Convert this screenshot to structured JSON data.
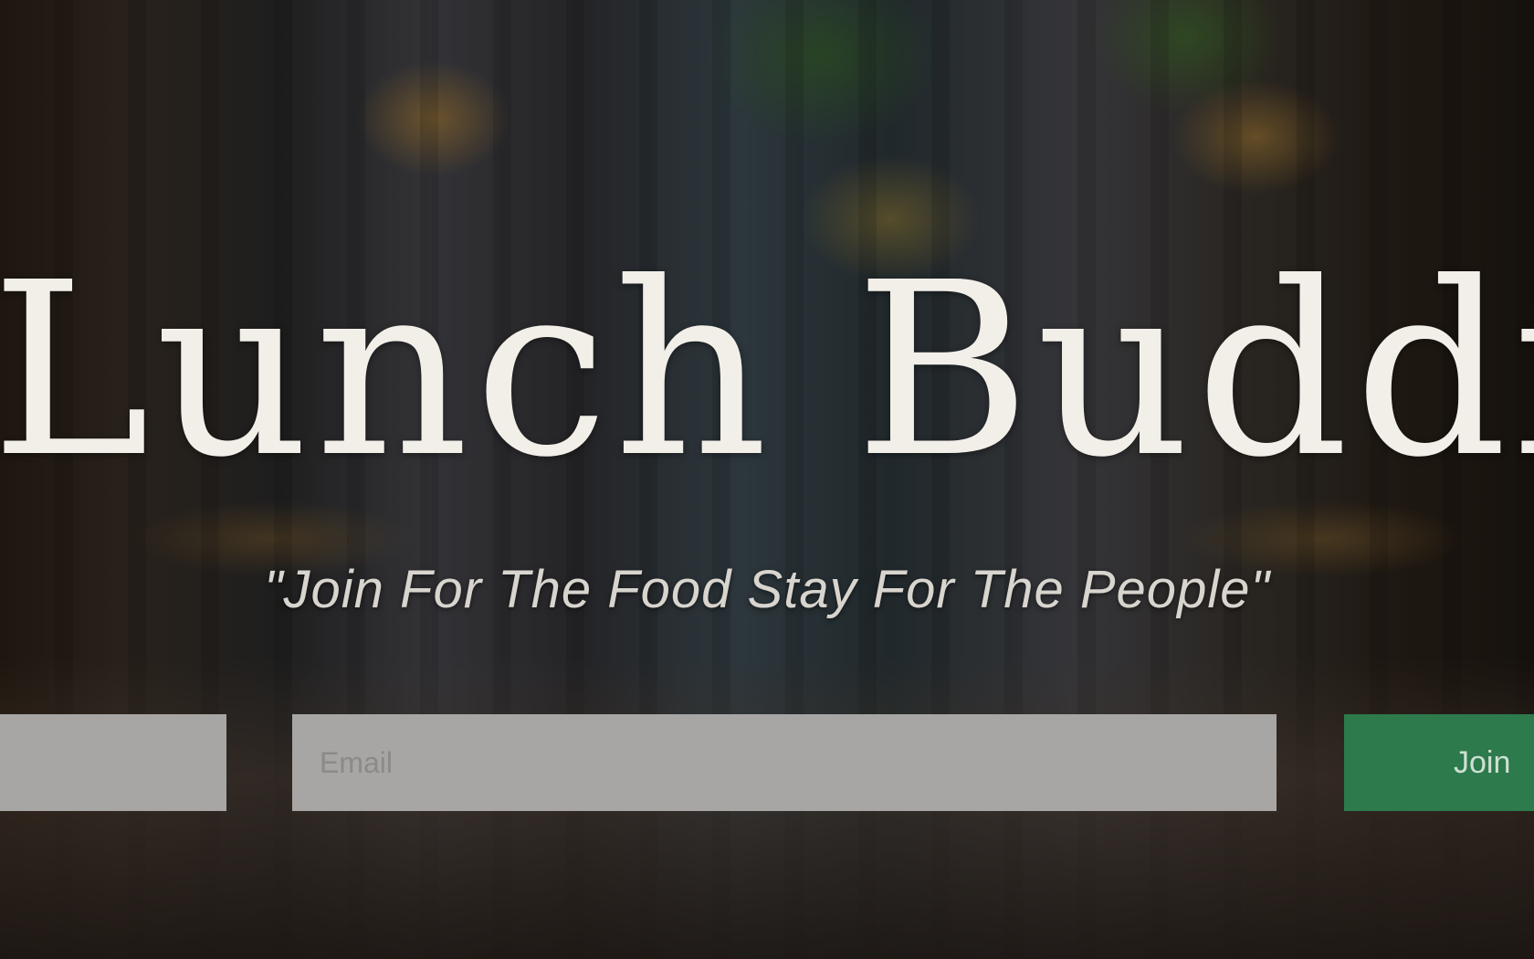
{
  "hero": {
    "title": "Lunch Buddies",
    "tagline": "\"Join For The Food Stay For The People\""
  },
  "form": {
    "name_placeholder": "",
    "email_placeholder": "Email",
    "submit_label": "Join"
  },
  "colors": {
    "title": "#f2efe9",
    "input_background": "#a8a6a4",
    "submit_background": "#2d7a4c"
  }
}
